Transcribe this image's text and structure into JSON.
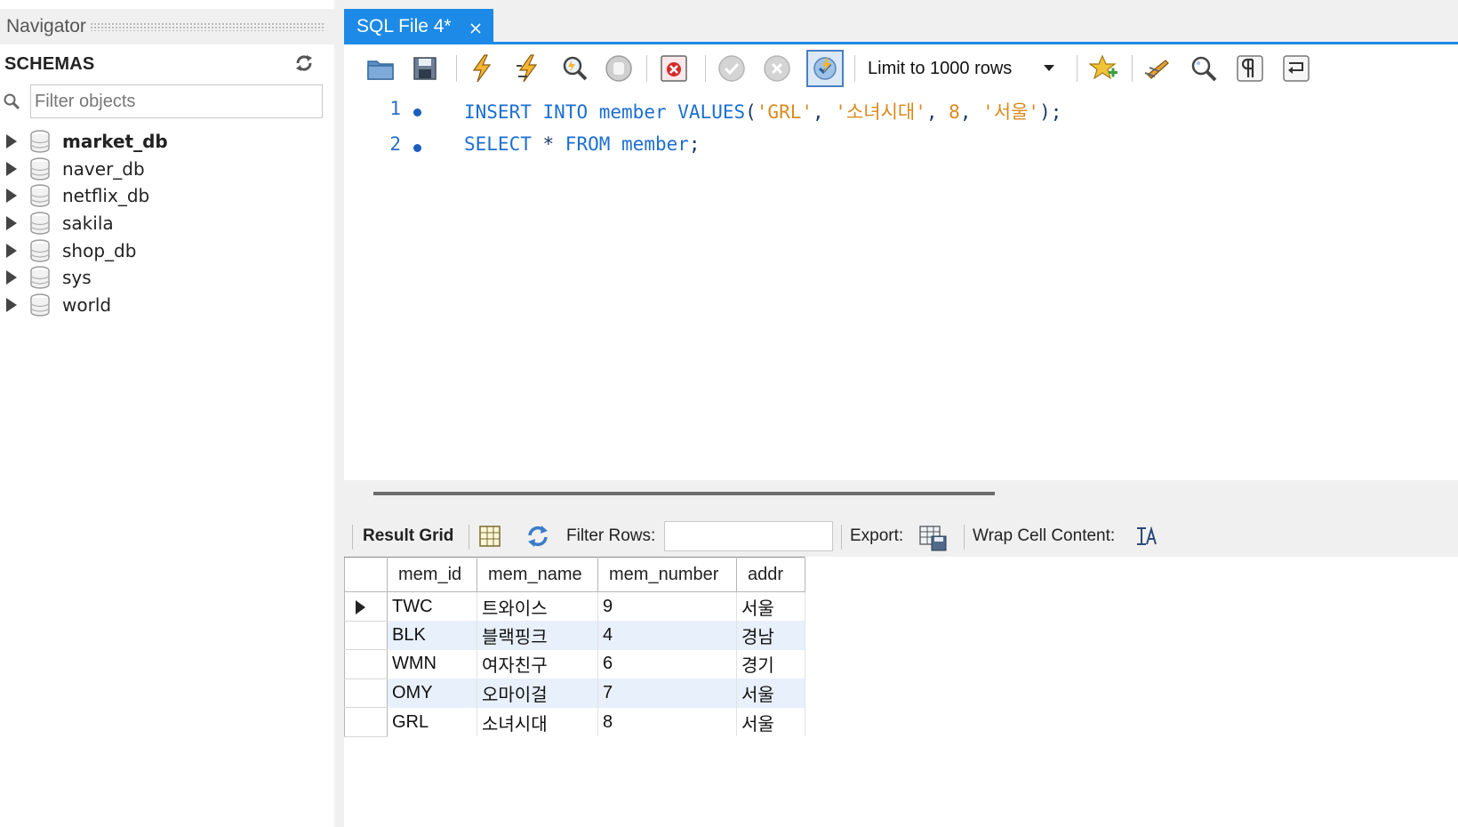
{
  "navigator": {
    "title": "Navigator",
    "schemas_label": "SCHEMAS",
    "filter_placeholder": "Filter objects",
    "schemas": [
      {
        "name": "market_db",
        "bold": true
      },
      {
        "name": "naver_db",
        "bold": false
      },
      {
        "name": "netflix_db",
        "bold": false
      },
      {
        "name": "sakila",
        "bold": false
      },
      {
        "name": "shop_db",
        "bold": false
      },
      {
        "name": "sys",
        "bold": false
      },
      {
        "name": "world",
        "bold": false
      }
    ]
  },
  "editor_tab": {
    "label": "SQL File 4*"
  },
  "toolbar": {
    "limit_label": "Limit to 1000 rows",
    "icons": [
      "open-folder-icon",
      "save-icon",
      "execute-icon",
      "execute-current-icon",
      "explain-icon",
      "stop-icon",
      "toggle-error-icon",
      "commit-icon",
      "rollback-icon",
      "autocommit-icon",
      "add-snippet-icon",
      "beautify-icon",
      "find-icon",
      "invisible-chars-icon",
      "wrap-icon"
    ]
  },
  "editor": {
    "lines": [
      {
        "number": "1",
        "tokens": [
          {
            "t": "INSERT",
            "c": "kw"
          },
          {
            "t": " ",
            "c": "punc"
          },
          {
            "t": "INTO",
            "c": "kw"
          },
          {
            "t": " ",
            "c": "punc"
          },
          {
            "t": "member",
            "c": "ident"
          },
          {
            "t": " ",
            "c": "punc"
          },
          {
            "t": "VALUES",
            "c": "kw"
          },
          {
            "t": "(",
            "c": "punc"
          },
          {
            "t": "'GRL'",
            "c": "str"
          },
          {
            "t": ", ",
            "c": "punc"
          },
          {
            "t": "'소녀시대'",
            "c": "str"
          },
          {
            "t": ", ",
            "c": "punc"
          },
          {
            "t": "8",
            "c": "num"
          },
          {
            "t": ", ",
            "c": "punc"
          },
          {
            "t": "'서울'",
            "c": "str"
          },
          {
            "t": ");",
            "c": "punc"
          }
        ]
      },
      {
        "number": "2",
        "tokens": [
          {
            "t": "SELECT",
            "c": "kw"
          },
          {
            "t": " * ",
            "c": "punc"
          },
          {
            "t": "FROM",
            "c": "kw"
          },
          {
            "t": " ",
            "c": "punc"
          },
          {
            "t": "member",
            "c": "ident"
          },
          {
            "t": ";",
            "c": "punc"
          }
        ]
      }
    ]
  },
  "result_toolbar": {
    "result_grid_label": "Result Grid",
    "filter_rows_label": "Filter Rows:",
    "export_label": "Export:",
    "wrap_label": "Wrap Cell Content:"
  },
  "result_grid": {
    "columns": [
      "mem_id",
      "mem_name",
      "mem_number",
      "addr"
    ],
    "rows": [
      [
        "TWC",
        "트와이스",
        "9",
        "서울"
      ],
      [
        "BLK",
        "블랙핑크",
        "4",
        "경남"
      ],
      [
        "WMN",
        "여자친구",
        "6",
        "경기"
      ],
      [
        "OMY",
        "오마이걸",
        "7",
        "서울"
      ],
      [
        "GRL",
        "소녀시대",
        "8",
        "서울"
      ]
    ]
  },
  "colors": {
    "accent": "#1c8ae6",
    "keyword": "#1c6fd1",
    "string": "#d98a1e",
    "alt_row": "#e8f0fb"
  }
}
